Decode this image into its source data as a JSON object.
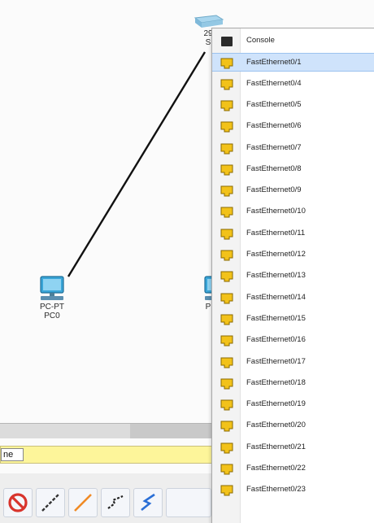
{
  "devices": {
    "pc0": {
      "type": "PC-PT",
      "name": "PC0"
    },
    "pc1": {
      "type": "P"
    },
    "switch0": {
      "type": "29",
      "name": "S"
    }
  },
  "name_field": {
    "value": "ne"
  },
  "port_menu": {
    "items": [
      {
        "label": "Console",
        "icon": "console-port-icon"
      },
      {
        "label": "FastEthernet0/1",
        "icon": "fastethernet-port-icon",
        "selected": true
      },
      {
        "label": "FastEthernet0/4",
        "icon": "fastethernet-port-icon"
      },
      {
        "label": "FastEthernet0/5",
        "icon": "fastethernet-port-icon"
      },
      {
        "label": "FastEthernet0/6",
        "icon": "fastethernet-port-icon"
      },
      {
        "label": "FastEthernet0/7",
        "icon": "fastethernet-port-icon"
      },
      {
        "label": "FastEthernet0/8",
        "icon": "fastethernet-port-icon"
      },
      {
        "label": "FastEthernet0/9",
        "icon": "fastethernet-port-icon"
      },
      {
        "label": "FastEthernet0/10",
        "icon": "fastethernet-port-icon"
      },
      {
        "label": "FastEthernet0/11",
        "icon": "fastethernet-port-icon"
      },
      {
        "label": "FastEthernet0/12",
        "icon": "fastethernet-port-icon"
      },
      {
        "label": "FastEthernet0/13",
        "icon": "fastethernet-port-icon"
      },
      {
        "label": "FastEthernet0/14",
        "icon": "fastethernet-port-icon"
      },
      {
        "label": "FastEthernet0/15",
        "icon": "fastethernet-port-icon"
      },
      {
        "label": "FastEthernet0/16",
        "icon": "fastethernet-port-icon"
      },
      {
        "label": "FastEthernet0/17",
        "icon": "fastethernet-port-icon"
      },
      {
        "label": "FastEthernet0/18",
        "icon": "fastethernet-port-icon"
      },
      {
        "label": "FastEthernet0/19",
        "icon": "fastethernet-port-icon"
      },
      {
        "label": "FastEthernet0/20",
        "icon": "fastethernet-port-icon"
      },
      {
        "label": "FastEthernet0/21",
        "icon": "fastethernet-port-icon"
      },
      {
        "label": "FastEthernet0/22",
        "icon": "fastethernet-port-icon"
      },
      {
        "label": "FastEthernet0/23",
        "icon": "fastethernet-port-icon"
      }
    ]
  },
  "toolbar": {
    "tools": [
      {
        "name": "cancel-connection-icon"
      },
      {
        "name": "automatic-connection-icon"
      },
      {
        "name": "straight-through-cable-icon"
      },
      {
        "name": "crossover-cable-icon"
      },
      {
        "name": "serial-cable-icon"
      }
    ]
  },
  "colors": {
    "accent_selection": "#cfe3fb",
    "port_icon_fill": "#f2c21a",
    "name_field_bg": "#fdf59a"
  }
}
